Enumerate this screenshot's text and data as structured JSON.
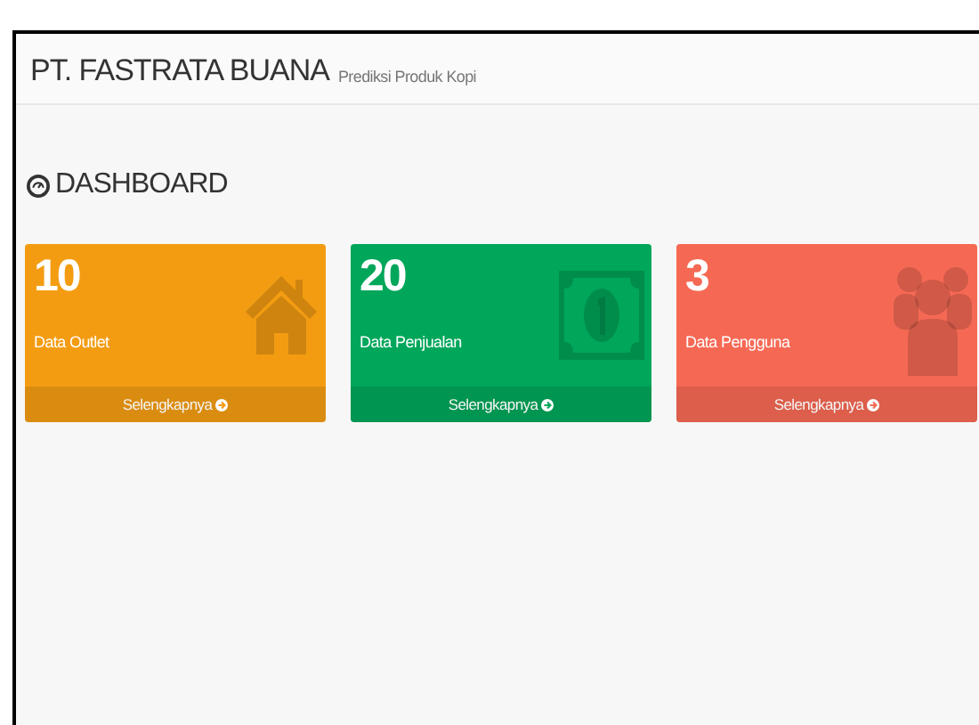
{
  "header": {
    "brand": "PT. FASTRATA BUANA",
    "subtitle": "Prediksi Produk Kopi"
  },
  "page_title": "DASHBOARD",
  "cards": [
    {
      "kind": "house",
      "count": "10",
      "label": "Data Outlet",
      "link": "Selengkapnya",
      "color": "#f39c12"
    },
    {
      "kind": "money",
      "count": "20",
      "label": "Data Penjualan",
      "link": "Selengkapnya",
      "color": "#00a65a"
    },
    {
      "kind": "users",
      "count": "3",
      "label": "Data Pengguna",
      "link": "Selengkapnya",
      "color": "#f56954"
    }
  ]
}
